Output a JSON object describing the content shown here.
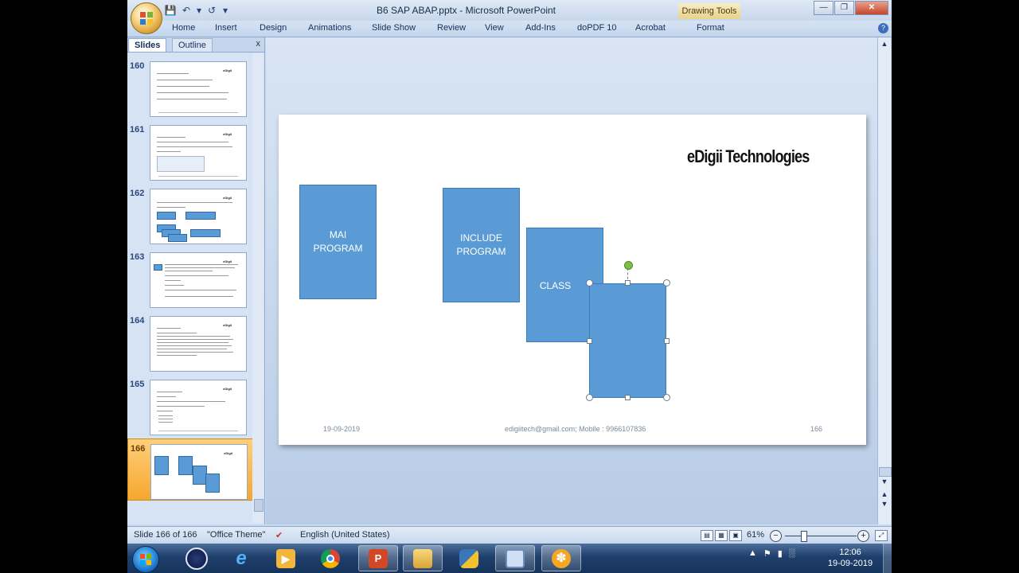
{
  "window": {
    "title": "B6 SAP ABAP.pptx - Microsoft PowerPoint",
    "context_tab": "Drawing Tools",
    "controls": [
      "minimize",
      "restore",
      "close"
    ]
  },
  "ribbon": {
    "tabs": [
      "Home",
      "Insert",
      "Design",
      "Animations",
      "Slide Show",
      "Review",
      "View",
      "Add-Ins",
      "doPDF 10",
      "Acrobat",
      "Format"
    ]
  },
  "left_pane": {
    "tabs": [
      "Slides",
      "Outline"
    ],
    "close_label": "x",
    "slides": [
      {
        "num": "160"
      },
      {
        "num": "161"
      },
      {
        "num": "162"
      },
      {
        "num": "163"
      },
      {
        "num": "164"
      },
      {
        "num": "165"
      },
      {
        "num": "166",
        "selected": true
      }
    ]
  },
  "slide": {
    "brand": "eDigii Technologies",
    "boxes": [
      "MAI PROGRAM",
      "INCLUDE PROGRAM",
      "CLASS",
      ""
    ],
    "footer_date": "19-09-2019",
    "footer_contact": "edigiitech@gmail.com;  Mobile : 9966107836",
    "footer_page": "166"
  },
  "status_bar": {
    "slide_info": "Slide 166 of 166",
    "theme": "\"Office Theme\"",
    "language": "English (United States)",
    "zoom": "61%"
  },
  "taskbar": {
    "apps": [
      "windows-media-icon",
      "internet-explorer-icon",
      "media-player-icon",
      "chrome-icon",
      "powerpoint-icon",
      "file-explorer-icon",
      "python-icon",
      "remote-desktop-icon",
      "snip-icon"
    ],
    "active_app": "powerpoint-icon",
    "time": "12:06",
    "date": "19-09-2019"
  },
  "colors": {
    "shape_fill": "#5b9bd5",
    "selection_orange": "#f5a72e",
    "ribbon_blue": "#c3d5ec"
  }
}
